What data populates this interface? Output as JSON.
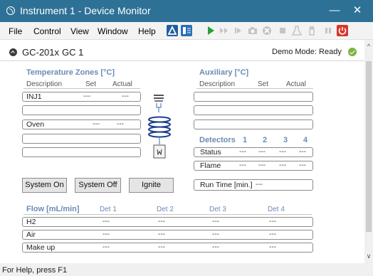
{
  "window": {
    "title": "Instrument 1 - Device Monitor",
    "minimize": "—",
    "close": "✕"
  },
  "menu": [
    "File",
    "Control",
    "View",
    "Window",
    "Help"
  ],
  "toolbar_icons": [
    "method-icon",
    "sequence-icon",
    "run-icon",
    "skip-icon",
    "step-icon",
    "camera-icon",
    "abort-icon",
    "stop-icon",
    "flask-icon",
    "vial-icon",
    "pause-icon",
    "power-icon"
  ],
  "colors": {
    "titlebar": "#2e7196",
    "section_title": "#6a8bb6",
    "run_green": "#27a03a",
    "power_red": "#d9352b",
    "ok_green": "#7cb342"
  },
  "device": {
    "model": "GC-201x",
    "id": "GC 1",
    "status": "Demo Mode: Ready"
  },
  "temperature": {
    "title": "Temperature Zones [°C]",
    "headers": {
      "description": "Description",
      "set": "Set",
      "actual": "Actual"
    },
    "rows": [
      {
        "description": "INJ1",
        "set": "---",
        "actual": "---"
      },
      {
        "description": "",
        "set": "",
        "actual": ""
      },
      {
        "description": "Oven",
        "set": "---",
        "actual": "---"
      },
      {
        "description": "",
        "set": "",
        "actual": ""
      },
      {
        "description": "",
        "set": "",
        "actual": ""
      }
    ]
  },
  "auxiliary": {
    "title": "Auxiliary [°C]",
    "headers": {
      "description": "Description",
      "set": "Set",
      "actual": "Actual"
    }
  },
  "detectors": {
    "title": "Detectors",
    "cols": [
      "1",
      "2",
      "3",
      "4"
    ],
    "rows": [
      {
        "label": "Status",
        "values": [
          "---",
          "---",
          "---",
          "---"
        ]
      },
      {
        "label": "Flame",
        "values": [
          "---",
          "---",
          "---",
          "---"
        ]
      }
    ]
  },
  "buttons": {
    "system_on": "System On",
    "system_off": "System Off",
    "ignite": "Ignite"
  },
  "run_time": {
    "label": "Run Time [min.]",
    "value": "---"
  },
  "flow": {
    "title": "Flow [mL/min]",
    "cols": [
      "Det 1",
      "Det 2",
      "Det 3",
      "Det 4"
    ],
    "rows": [
      {
        "label": "H2",
        "values": [
          "---",
          "---",
          "---",
          "---"
        ]
      },
      {
        "label": "Air",
        "values": [
          "---",
          "---",
          "---",
          "---"
        ]
      },
      {
        "label": "Make up",
        "values": [
          "---",
          "---",
          "---",
          "---"
        ]
      }
    ]
  },
  "statusbar": "For Help, press F1"
}
